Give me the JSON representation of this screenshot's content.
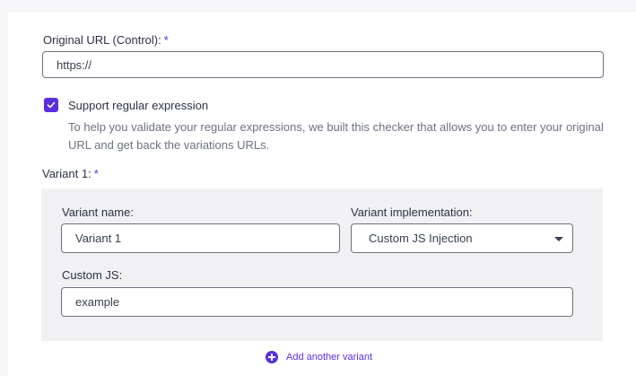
{
  "original_url": {
    "label": "Original URL (Control):",
    "required_mark": "*",
    "value": "https://"
  },
  "regex": {
    "checked": true,
    "label": "Support regular expression",
    "help_text": "To help you validate your regular expressions, we built this checker that allows you to enter your original URL and get back the variations URLs."
  },
  "variant1": {
    "label": "Variant 1:",
    "required_mark": "*",
    "name_label": "Variant name:",
    "name_value": "Variant 1",
    "implementation_label": "Variant implementation:",
    "implementation_value": "Custom JS Injection",
    "custom_js_label": "Custom JS:",
    "custom_js_value": "example"
  },
  "add_variant_label": "Add another variant",
  "colors": {
    "accent": "#5b2fe0",
    "panel_bg": "#f1f1f4",
    "border": "#6b7280"
  },
  "icons": {
    "checkbox": "checkmark-icon",
    "dropdown": "caret-down-icon",
    "add": "plus-circle-icon"
  }
}
